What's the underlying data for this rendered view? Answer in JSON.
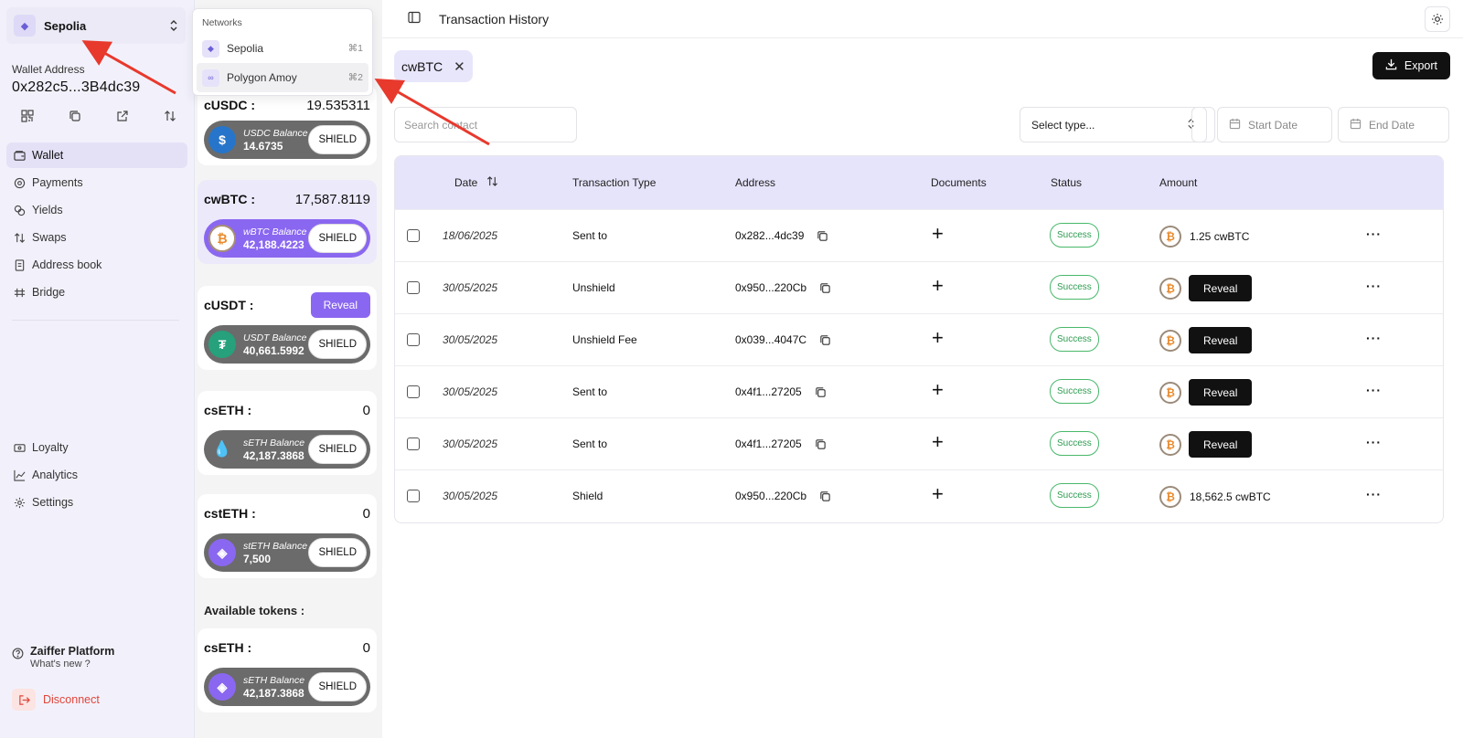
{
  "network_selector": {
    "name": "Sepolia"
  },
  "wallet": {
    "label": "Wallet Address",
    "address": "0x282c5...3B4dc39"
  },
  "nav_top": [
    {
      "label": "Wallet",
      "icon": "wallet-icon"
    },
    {
      "label": "Payments",
      "icon": "payments-icon"
    },
    {
      "label": "Yields",
      "icon": "yields-icon"
    },
    {
      "label": "Swaps",
      "icon": "swaps-icon"
    },
    {
      "label": "Address book",
      "icon": "address-book-icon"
    },
    {
      "label": "Bridge",
      "icon": "bridge-icon"
    }
  ],
  "nav_bottom": [
    {
      "label": "Loyalty",
      "icon": "loyalty-icon"
    },
    {
      "label": "Analytics",
      "icon": "analytics-icon"
    },
    {
      "label": "Settings",
      "icon": "settings-icon"
    }
  ],
  "footer": {
    "platform": "Zaiffer Platform",
    "whats_new": "What's new ?",
    "disconnect": "Disconnect"
  },
  "dropdown": {
    "header": "Networks",
    "items": [
      {
        "label": "Sepolia",
        "shortcut": "⌘1"
      },
      {
        "label": "Polygon Amoy",
        "shortcut": "⌘2"
      }
    ]
  },
  "tokens": [
    {
      "symbol": "cUSDC :",
      "amount": "19.535311",
      "balance_label": "USDC Balance",
      "balance": "14.6735",
      "shield": "SHIELD"
    },
    {
      "symbol": "cwBTC :",
      "amount": "17,587.8119",
      "balance_label": "wBTC Balance",
      "balance": "42,188.4223",
      "shield": "SHIELD"
    },
    {
      "symbol": "cUSDT :",
      "reveal": "Reveal",
      "balance_label": "USDT Balance",
      "balance": "40,661.5992",
      "shield": "SHIELD"
    },
    {
      "symbol": "csETH :",
      "amount": "0",
      "balance_label": "sETH Balance",
      "balance": "42,187.3868",
      "shield": "SHIELD"
    },
    {
      "symbol": "cstETH :",
      "amount": "0",
      "balance_label": "stETH Balance",
      "balance": "7,500",
      "shield": "SHIELD"
    },
    {
      "symbol": "csETH :",
      "amount": "0",
      "balance_label": "sETH Balance",
      "balance": "42,187.3868",
      "shield": "SHIELD"
    }
  ],
  "available_tokens_label": "Available tokens :",
  "header": {
    "title": "Transaction History"
  },
  "filter_chip": "cwBTC",
  "export_label": "Export",
  "search": {
    "placeholder": "Search contact"
  },
  "type_select": "Select type...",
  "start_date": "Start Date",
  "end_date": "End Date",
  "table": {
    "columns": [
      "Date",
      "Transaction Type",
      "Address",
      "Documents",
      "Status",
      "Amount"
    ],
    "rows": [
      {
        "date": "18/06/2025",
        "type": "Sent to",
        "address": "0x282...4dc39",
        "status": "Success",
        "amount": "1.25 cwBTC"
      },
      {
        "date": "30/05/2025",
        "type": "Unshield",
        "address": "0x950...220Cb",
        "status": "Success",
        "reveal": "Reveal"
      },
      {
        "date": "30/05/2025",
        "type": "Unshield Fee",
        "address": "0x039...4047C",
        "status": "Success",
        "reveal": "Reveal"
      },
      {
        "date": "30/05/2025",
        "type": "Sent to",
        "address": "0x4f1...27205",
        "status": "Success",
        "reveal": "Reveal"
      },
      {
        "date": "30/05/2025",
        "type": "Sent to",
        "address": "0x4f1...27205",
        "status": "Success",
        "reveal": "Reveal"
      },
      {
        "date": "30/05/2025",
        "type": "Shield",
        "address": "0x950...220Cb",
        "status": "Success",
        "amount": "18,562.5 cwBTC"
      }
    ]
  },
  "colors": {
    "accent": "#8a67f0",
    "sidebar": "#f2f1fb",
    "table_header": "#e6e4fb",
    "success": "#2f9c52",
    "danger": "#e0453a",
    "annotation_arrow": "#e8392d"
  }
}
